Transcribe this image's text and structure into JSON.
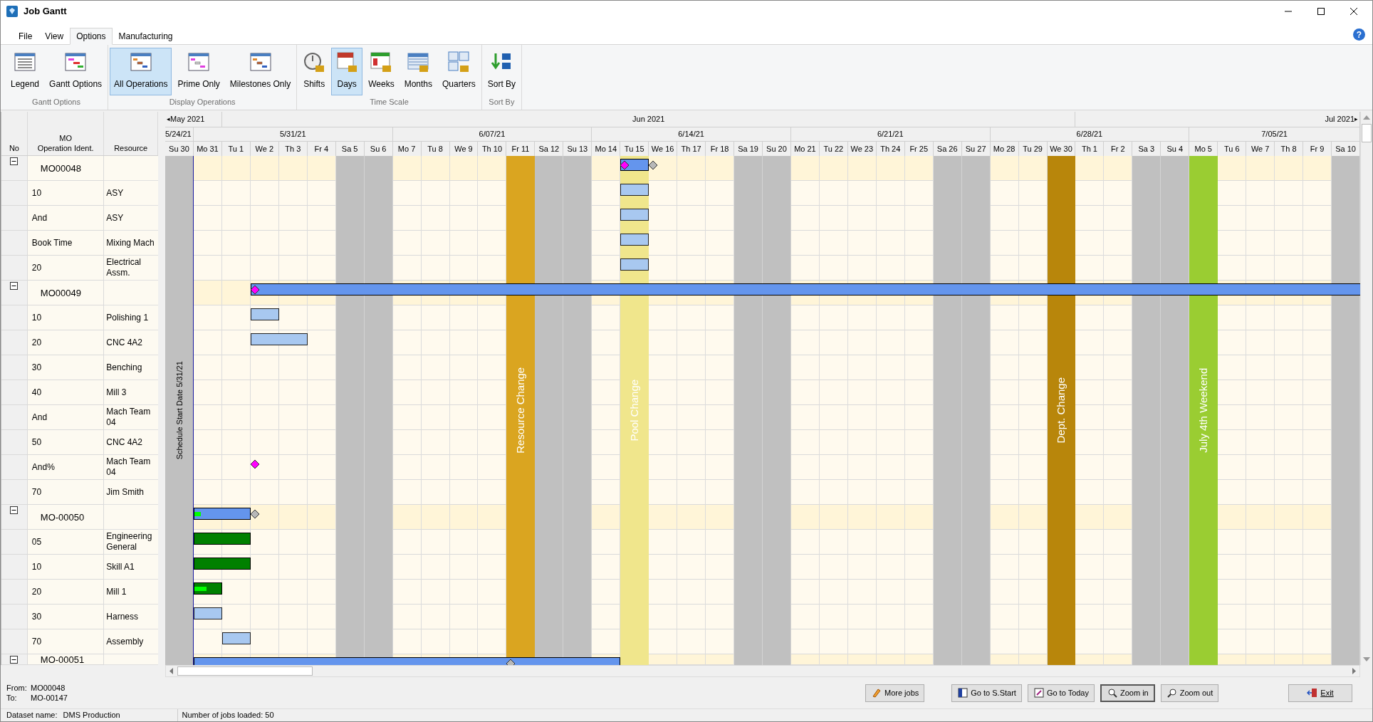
{
  "window": {
    "title": "Job Gantt"
  },
  "menu_tabs": [
    {
      "label": "File",
      "selected": false
    },
    {
      "label": "View",
      "selected": false
    },
    {
      "label": "Options",
      "selected": true
    },
    {
      "label": "Manufacturing",
      "selected": false
    }
  ],
  "help": "?",
  "ribbon": [
    {
      "title": "Gantt Options",
      "buttons": [
        {
          "label": "Legend",
          "selected": false
        },
        {
          "label": "Gantt Options",
          "selected": false
        }
      ]
    },
    {
      "title": "Display Operations",
      "buttons": [
        {
          "label": "All Operations",
          "selected": true
        },
        {
          "label": "Prime Only",
          "selected": false
        },
        {
          "label": "Milestones Only",
          "selected": false
        }
      ]
    },
    {
      "title": "Time Scale",
      "buttons": [
        {
          "label": "Shifts",
          "selected": false
        },
        {
          "label": "Days",
          "selected": true
        },
        {
          "label": "Weeks",
          "selected": false
        },
        {
          "label": "Months",
          "selected": false
        },
        {
          "label": "Quarters",
          "selected": false
        }
      ]
    },
    {
      "title": "Sort By",
      "buttons": [
        {
          "label": "Sort By",
          "selected": false
        }
      ]
    }
  ],
  "grid": {
    "columns": [
      "No",
      "MO\nOperation Ident.",
      "Resource"
    ]
  },
  "timeline": {
    "prev_arrow": "◂",
    "next_arrow": "▸",
    "months": [
      {
        "label": "May 2021"
      },
      {
        "label": "Jun 2021"
      },
      {
        "label": "Jul 2021"
      }
    ],
    "weeks": [
      {
        "label": "5/24/21",
        "days": [
          {
            "label": "Su 30",
            "kind": "weekend",
            "note": "Schedule Start Date 5/31/21"
          }
        ]
      },
      {
        "label": "5/31/21",
        "days": [
          {
            "label": "Mo 31",
            "kind": "workday"
          },
          {
            "label": "Tu 1",
            "kind": "workday"
          },
          {
            "label": "We 2",
            "kind": "workday"
          },
          {
            "label": "Th 3",
            "kind": "workday"
          },
          {
            "label": "Fr 4",
            "kind": "workday"
          },
          {
            "label": "Sa 5",
            "kind": "weekend"
          },
          {
            "label": "Su 6",
            "kind": "weekend"
          }
        ]
      },
      {
        "label": "6/07/21",
        "days": [
          {
            "label": "Mo 7",
            "kind": "workday"
          },
          {
            "label": "Tu 8",
            "kind": "workday"
          },
          {
            "label": "We 9",
            "kind": "workday"
          },
          {
            "label": "Th 10",
            "kind": "workday"
          },
          {
            "label": "Fr 11",
            "kind": "event",
            "color": "#daa520",
            "note": "Resource Change"
          },
          {
            "label": "Sa 12",
            "kind": "weekend"
          },
          {
            "label": "Su 13",
            "kind": "weekend"
          }
        ]
      },
      {
        "label": "6/14/21",
        "days": [
          {
            "label": "Mo 14",
            "kind": "workday"
          },
          {
            "label": "Tu 15",
            "kind": "event",
            "color": "#f0e68c",
            "note": "Pool Change"
          },
          {
            "label": "We 16",
            "kind": "workday"
          },
          {
            "label": "Th 17",
            "kind": "workday"
          },
          {
            "label": "Fr 18",
            "kind": "workday"
          },
          {
            "label": "Sa 19",
            "kind": "weekend"
          },
          {
            "label": "Su 20",
            "kind": "weekend"
          }
        ]
      },
      {
        "label": "6/21/21",
        "days": [
          {
            "label": "Mo 21",
            "kind": "workday"
          },
          {
            "label": "Tu 22",
            "kind": "workday"
          },
          {
            "label": "We 23",
            "kind": "workday"
          },
          {
            "label": "Th 24",
            "kind": "workday"
          },
          {
            "label": "Fr 25",
            "kind": "workday"
          },
          {
            "label": "Sa 26",
            "kind": "weekend"
          },
          {
            "label": "Su 27",
            "kind": "weekend"
          }
        ]
      },
      {
        "label": "6/28/21",
        "days": [
          {
            "label": "Mo 28",
            "kind": "workday"
          },
          {
            "label": "Tu 29",
            "kind": "workday"
          },
          {
            "label": "We 30",
            "kind": "event",
            "color": "#b8860b",
            "note": "Dept. Change"
          },
          {
            "label": "Th 1",
            "kind": "workday"
          },
          {
            "label": "Fr 2",
            "kind": "workday"
          },
          {
            "label": "Sa 3",
            "kind": "weekend"
          },
          {
            "label": "Su 4",
            "kind": "weekend"
          }
        ]
      },
      {
        "label": "7/05/21",
        "days": [
          {
            "label": "Mo 5",
            "kind": "event",
            "color": "#9acd32",
            "note": "July 4th Weekend"
          },
          {
            "label": "Tu 6",
            "kind": "workday"
          },
          {
            "label": "We 7",
            "kind": "workday"
          },
          {
            "label": "Th 8",
            "kind": "workday"
          },
          {
            "label": "Fr 9",
            "kind": "workday"
          },
          {
            "label": "Sa 10",
            "kind": "weekend"
          }
        ]
      }
    ]
  },
  "rows": [
    {
      "kind": "mo",
      "id": "MO00048",
      "expanded": true,
      "bars": [
        {
          "kind": "summary"
        }
      ],
      "markers": [
        {
          "kind": "milestone"
        },
        {
          "kind": "finish"
        }
      ]
    },
    {
      "kind": "op",
      "id": "10",
      "resource": "ASY",
      "bars": [
        {
          "kind": "operation"
        }
      ]
    },
    {
      "kind": "op",
      "id": "And",
      "resource": "ASY",
      "bars": [
        {
          "kind": "operation"
        }
      ]
    },
    {
      "kind": "op",
      "id": "Book Time",
      "resource": "Mixing Mach",
      "bars": [
        {
          "kind": "operation"
        }
      ]
    },
    {
      "kind": "op",
      "id": "20",
      "resource": "Electrical Assm.",
      "bars": [
        {
          "kind": "operation"
        }
      ]
    },
    {
      "kind": "mo",
      "id": "MO00049",
      "expanded": true,
      "bars": [
        {
          "kind": "summary"
        }
      ],
      "markers": [
        {
          "kind": "milestone"
        }
      ]
    },
    {
      "kind": "op",
      "id": "10",
      "resource": "Polishing 1",
      "bars": [
        {
          "kind": "operation"
        }
      ]
    },
    {
      "kind": "op",
      "id": "20",
      "resource": "CNC 4A2",
      "bars": [
        {
          "kind": "operation"
        }
      ]
    },
    {
      "kind": "op",
      "id": "30",
      "resource": "Benching"
    },
    {
      "kind": "op",
      "id": "40",
      "resource": "Mill 3"
    },
    {
      "kind": "op",
      "id": "And",
      "resource": "Mach Team 04"
    },
    {
      "kind": "op",
      "id": "50",
      "resource": "CNC 4A2"
    },
    {
      "kind": "op",
      "id": "And%",
      "resource": "Mach Team 04",
      "markers": [
        {
          "kind": "milestone"
        }
      ]
    },
    {
      "kind": "op",
      "id": "70",
      "resource": "Jim Smith"
    },
    {
      "kind": "mo",
      "id": "MO-00050",
      "expanded": true,
      "bars": [
        {
          "kind": "summary",
          "level": 0.12
        }
      ],
      "markers": [
        {
          "kind": "finish"
        }
      ]
    },
    {
      "kind": "op",
      "id": "05",
      "resource": "Engineering General",
      "bars": [
        {
          "kind": "labor"
        }
      ]
    },
    {
      "kind": "op",
      "id": "10",
      "resource": "Skill A1",
      "bars": [
        {
          "kind": "labor"
        }
      ]
    },
    {
      "kind": "op",
      "id": "20",
      "resource": "Mill 1",
      "bars": [
        {
          "kind": "labor",
          "level": 0.45
        }
      ]
    },
    {
      "kind": "op",
      "id": "30",
      "resource": "Harness",
      "bars": [
        {
          "kind": "operation"
        }
      ]
    },
    {
      "kind": "op",
      "id": "70",
      "resource": "Assembly",
      "bars": [
        {
          "kind": "operation"
        }
      ]
    },
    {
      "kind": "mo",
      "id": "MO-00051",
      "expanded": true,
      "bars": [
        {
          "kind": "summary"
        }
      ],
      "markers": [
        {
          "kind": "finish"
        }
      ]
    }
  ],
  "footer": {
    "range": [
      {
        "label": "From:",
        "value": "MO00048"
      },
      {
        "label": "To:",
        "value": "MO-00147"
      }
    ],
    "buttons": [
      {
        "label": "More jobs",
        "selected": false
      },
      {
        "label": "Go to S.Start",
        "selected": false
      },
      {
        "label": "Go to Today",
        "selected": false
      },
      {
        "label": "Zoom in",
        "selected": true
      },
      {
        "label": "Zoom out",
        "selected": false
      }
    ],
    "exit": "Exit"
  },
  "status": {
    "dataset_label": "Dataset name:",
    "dataset": "DMS Production",
    "jobs": "Number of jobs loaded: 50"
  }
}
